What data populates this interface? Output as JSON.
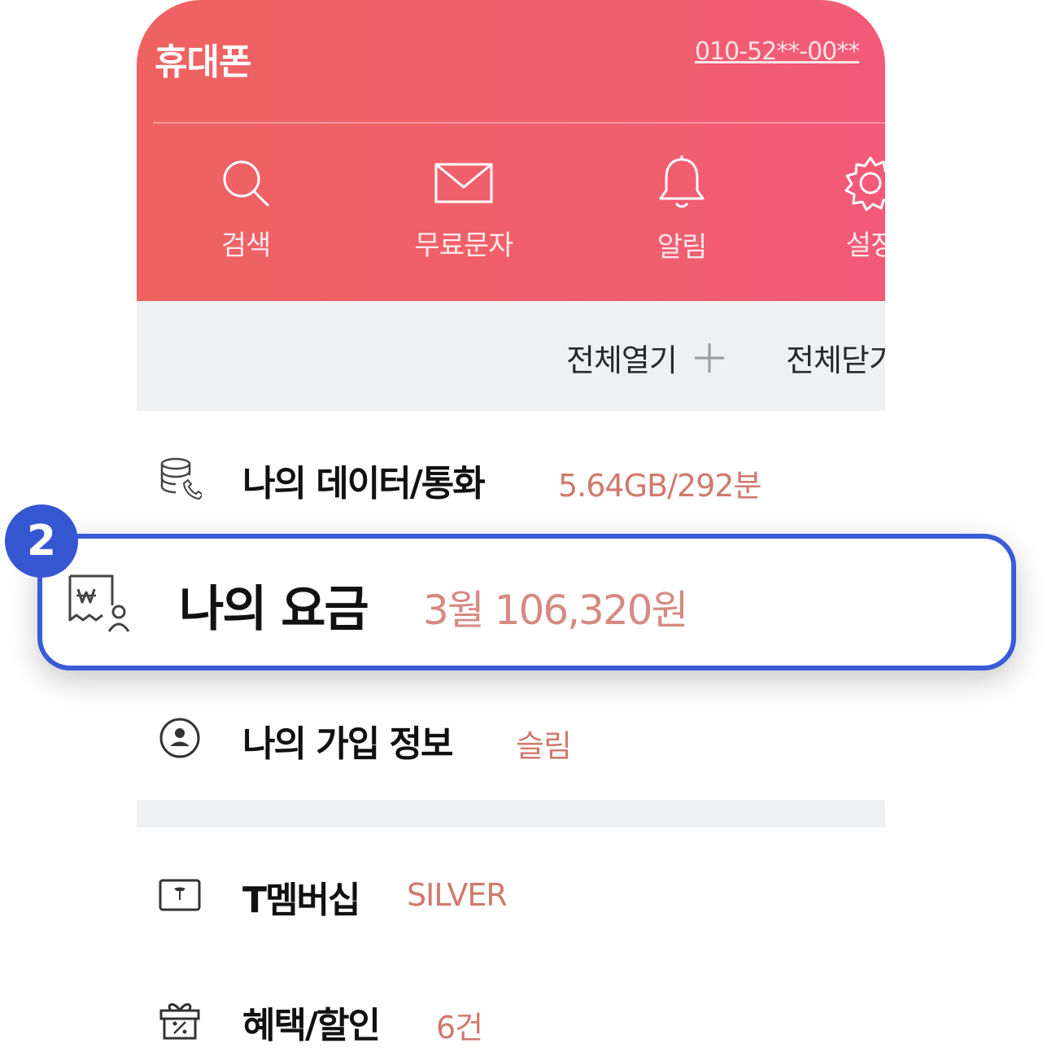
{
  "header": {
    "title": "휴대폰",
    "phone_number": "010-52**-00**",
    "quick_menu": [
      {
        "label": "검색",
        "icon": "search-icon"
      },
      {
        "label": "무료문자",
        "icon": "envelope-icon"
      },
      {
        "label": "알림",
        "icon": "bell-icon"
      },
      {
        "label": "설정",
        "icon": "gear-icon"
      }
    ]
  },
  "toolbar": {
    "expand_all": "전체열기",
    "collapse_all": "전체닫기"
  },
  "menu": {
    "data_call": {
      "title": "나의 데이터/통화",
      "value": "5.64GB/292분",
      "icon": "data-call-icon"
    },
    "billing": {
      "title": "나의 요금",
      "value": "3월 106,320원",
      "icon": "bill-icon"
    },
    "subscription": {
      "title": "나의 가입 정보",
      "value": "슬림",
      "icon": "user-circle-icon"
    },
    "membership": {
      "title": "T멤버십",
      "value": "SILVER",
      "icon": "membership-card-icon"
    },
    "benefits": {
      "title": "혜택/할인",
      "value": "6건",
      "icon": "gift-discount-icon"
    }
  },
  "step_badge": "2",
  "colors": {
    "header_start": "#ee6262",
    "header_end": "#f25a78",
    "highlight_border": "#3a5bd6",
    "badge": "#3557d2",
    "value_text": "#cf7a6e"
  }
}
